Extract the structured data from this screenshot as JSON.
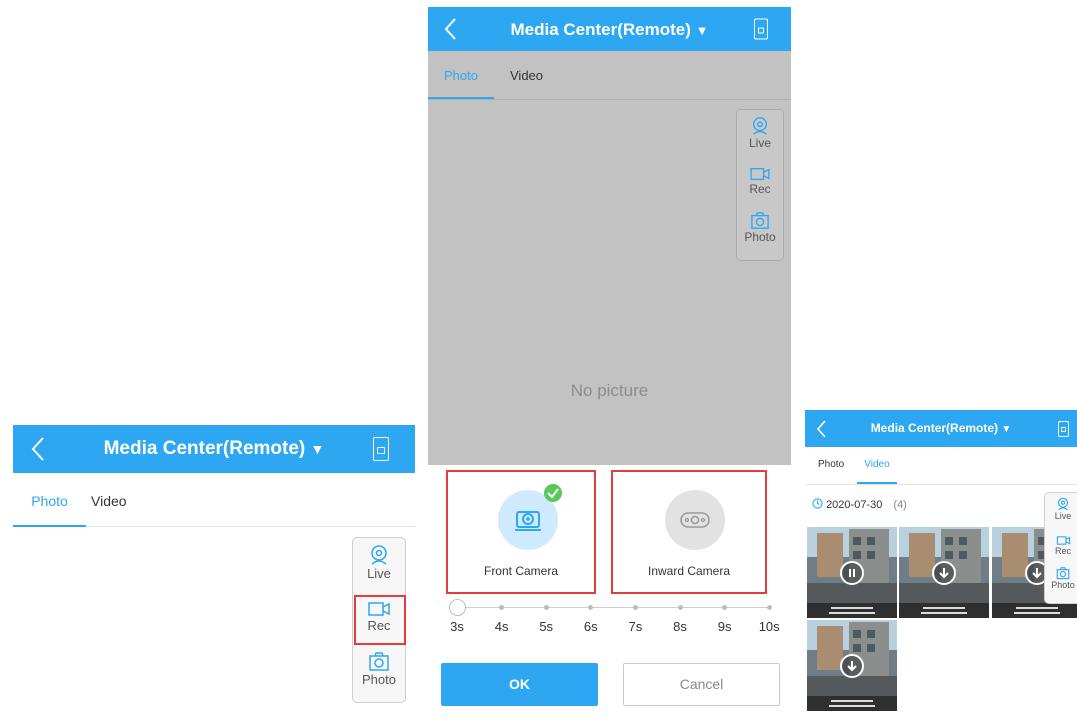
{
  "app": {
    "title": "Media Center(Remote)",
    "title_arrow": "▼",
    "tabs": {
      "photo": "Photo",
      "video": "Video"
    }
  },
  "toolbar": {
    "live": "Live",
    "rec": "Rec",
    "photo": "Photo"
  },
  "main": {
    "empty_text": "No picture",
    "cameras": {
      "front": "Front Camera",
      "inward": "Inward Camera",
      "selected": "Front Camera"
    },
    "duration": {
      "options": [
        "3s",
        "4s",
        "5s",
        "6s",
        "7s",
        "8s",
        "9s",
        "10s"
      ],
      "selected": "3s"
    },
    "ok": "OK",
    "cancel": "Cancel"
  },
  "gallery": {
    "date": "2020-07-30",
    "count": "(4)",
    "thumbnails": [
      {
        "state": "pause-icon"
      },
      {
        "state": "download-icon"
      },
      {
        "state": "download-icon"
      },
      {
        "state": "download-icon"
      }
    ]
  },
  "colors": {
    "accent": "#2ea7f2",
    "highlight": "#e23c3c",
    "check": "#5ac85a"
  }
}
